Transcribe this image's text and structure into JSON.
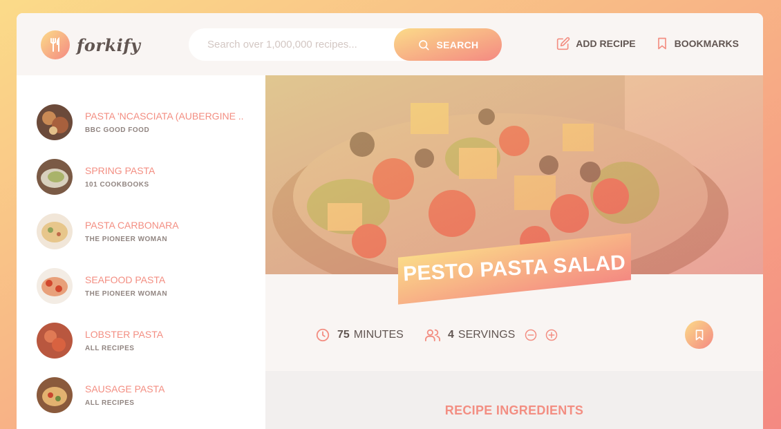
{
  "app": {
    "name": "forkify"
  },
  "search": {
    "placeholder": "Search over 1,000,000 recipes...",
    "value": "",
    "button_label": "SEARCH"
  },
  "nav": {
    "add_recipe": "ADD RECIPE",
    "bookmarks": "BOOKMARKS"
  },
  "results": [
    {
      "title": "PASTA 'NCASCIATA (AUBERGINE ...",
      "publisher": "BBC GOOD FOOD"
    },
    {
      "title": "SPRING PASTA",
      "publisher": "101 COOKBOOKS"
    },
    {
      "title": "PASTA CARBONARA",
      "publisher": "THE PIONEER WOMAN"
    },
    {
      "title": "SEAFOOD PASTA",
      "publisher": "THE PIONEER WOMAN"
    },
    {
      "title": "LOBSTER PASTA",
      "publisher": "ALL RECIPES"
    },
    {
      "title": "SAUSAGE PASTA",
      "publisher": "ALL RECIPES"
    }
  ],
  "recipe": {
    "title": "PESTO PASTA SALAD",
    "minutes": "75",
    "minutes_label": "MINUTES",
    "servings": "4",
    "servings_label": "SERVINGS",
    "ingredients_heading": "RECIPE INGREDIENTS"
  },
  "colors": {
    "accent_start": "#fbdb89",
    "accent_end": "#f48982",
    "title_text": "#f38e82",
    "body_text": "#615551"
  },
  "icons": [
    "fork-logo-icon",
    "search-icon",
    "edit-icon",
    "bookmark-icon",
    "clock-icon",
    "users-icon",
    "minus-circle-icon",
    "plus-circle-icon"
  ]
}
